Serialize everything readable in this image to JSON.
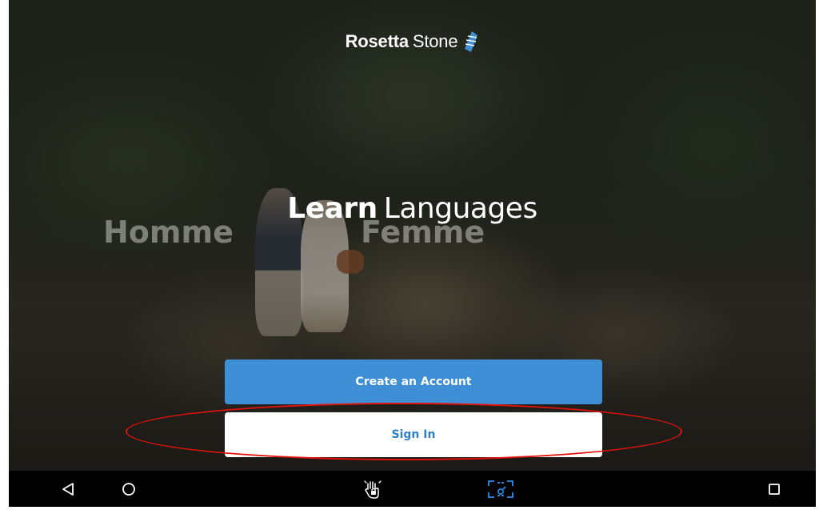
{
  "brand": {
    "name_bold": "Rosetta",
    "name_light": "Stone",
    "accent_color": "#3f8fd6"
  },
  "background_words": {
    "left": "Homme",
    "right": "Femme"
  },
  "headline": {
    "bold": "Learn",
    "light": "Languages"
  },
  "actions": {
    "create_account_label": "Create an Account",
    "sign_in_label": "Sign In"
  },
  "annotation": {
    "highlight_color": "#e3120b",
    "highlighted_target": "sign-in-button"
  },
  "system_nav": {
    "back_icon": "back-triangle-icon",
    "home_icon": "home-circle-icon",
    "gesture_icon": "hand-gesture-lock-icon",
    "screenshot_icon": "screen-capture-icon",
    "recents_icon": "recents-square-icon",
    "screenshot_icon_color": "#2f7fd0"
  }
}
